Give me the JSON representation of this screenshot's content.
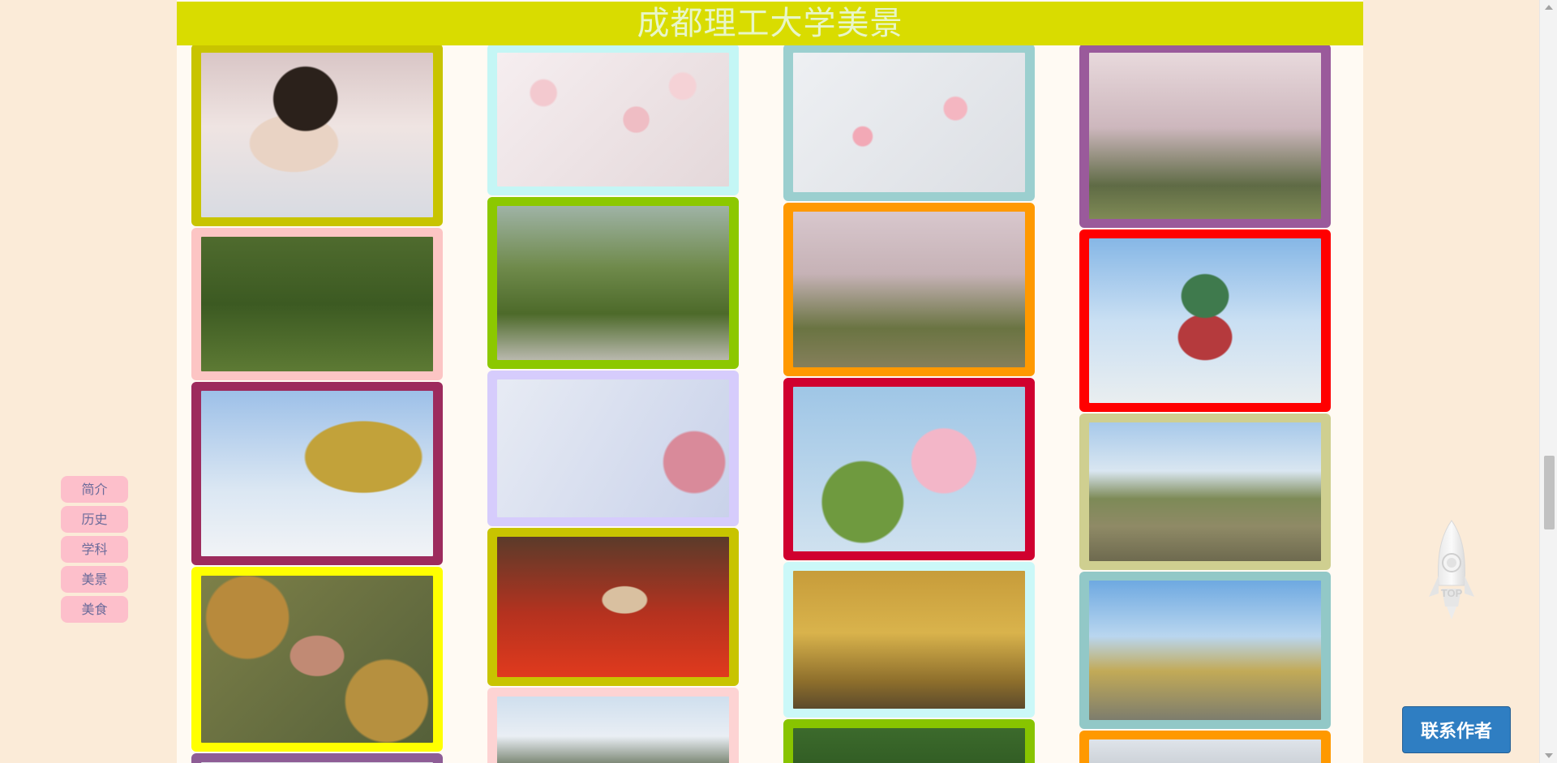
{
  "header": {
    "title": "成都理工大学美景"
  },
  "side_nav": {
    "items": [
      {
        "label": "简介"
      },
      {
        "label": "历史"
      },
      {
        "label": "学科"
      },
      {
        "label": "美景"
      },
      {
        "label": "美食"
      }
    ]
  },
  "back_to_top": {
    "label": "TOP"
  },
  "contact_button": {
    "label": "联系作者"
  },
  "gallery": {
    "columns": [
      [
        {
          "frame_color": "#c8c400",
          "photo": "camera-blossoms"
        },
        {
          "frame_color": "#fcc5c4",
          "photo": "grass-petals"
        },
        {
          "frame_color": "#9d2b5d",
          "photo": "acacia-sky"
        },
        {
          "frame_color": "#ffff00",
          "photo": "aerial-courtyard"
        },
        {
          "frame_color": "#8e5d96",
          "photo": "partial"
        }
      ],
      [
        {
          "frame_color": "#c4f6f5",
          "photo": "cherry-blossom-branches"
        },
        {
          "frame_color": "#8cc800",
          "photo": "park-path"
        },
        {
          "frame_color": "#d6ccfc",
          "photo": "crabapple-sky"
        },
        {
          "frame_color": "#c8c400",
          "photo": "red-pavilion"
        },
        {
          "frame_color": "#fdd3d3",
          "photo": "building-tree"
        }
      ],
      [
        {
          "frame_color": "#9bcfcf",
          "photo": "plum-blossom"
        },
        {
          "frame_color": "#ff9900",
          "photo": "blossom-grove"
        },
        {
          "frame_color": "#d0002f",
          "photo": "crabapple-bee"
        },
        {
          "frame_color": "#cbf8f8",
          "photo": "ginkgo-steps"
        },
        {
          "frame_color": "#88c400",
          "photo": "lotus-leaf"
        }
      ],
      [
        {
          "frame_color": "#9a5a9b",
          "photo": "pink-tree-grove"
        },
        {
          "frame_color": "#ff0000",
          "photo": "green-roof-pavilion"
        },
        {
          "frame_color": "#cfcf90",
          "photo": "lake-building"
        },
        {
          "frame_color": "#92c8c7",
          "photo": "ginkgo-road"
        },
        {
          "frame_color": "#ff9900",
          "photo": "sky"
        }
      ]
    ]
  }
}
